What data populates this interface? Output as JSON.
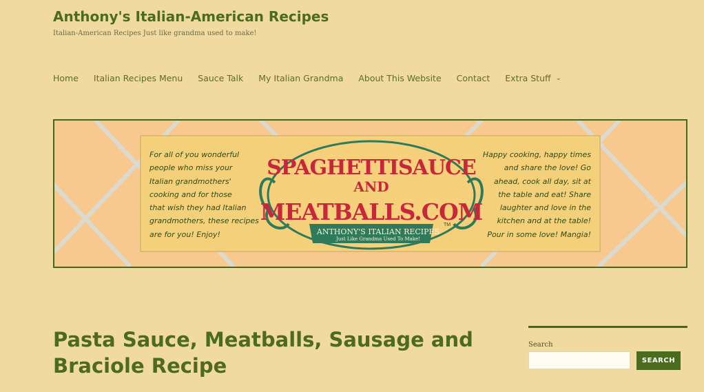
{
  "site": {
    "title": "Anthony's Italian-American Recipes",
    "tagline": "Italian-American Recipes Just like grandma used to make!"
  },
  "nav": {
    "items": [
      {
        "label": "Home"
      },
      {
        "label": "Italian Recipes Menu"
      },
      {
        "label": "Sauce Talk"
      },
      {
        "label": "My Italian Grandma"
      },
      {
        "label": "About This Website"
      },
      {
        "label": "Contact"
      },
      {
        "label": "Extra Stuff",
        "has_dropdown": true
      }
    ],
    "dropdown_icon": "chevron-down-icon"
  },
  "banner": {
    "left_lines": [
      "For all of you wonderful",
      "people who miss your",
      "Italian grandmothers'",
      "cooking and for those",
      "that wish they had Italian",
      "grandmothers, these recipes",
      "are for you! Enjoy!"
    ],
    "right_lines": [
      "Happy cooking, happy times",
      "and share the love! Go",
      "ahead, cook all day, sit at",
      "the table and eat! Share",
      "laughter and love in the",
      "kitchen and at the table!",
      "Pour in some love! Mangia!"
    ],
    "logo_line1": "SPAGHETTISAUCE",
    "logo_and": "AND",
    "logo_line2": "MEATBALLS.COM",
    "logo_tm": "TM",
    "logo_sub1": "ANTHONY'S ITALIAN RECIPES",
    "logo_sub2": "Just Like Grandma Used To Make!"
  },
  "post": {
    "title_line1": "Pasta Sauce, Meatballs, Sausage and",
    "title_line2": "Braciole Recipe"
  },
  "sidebar": {
    "search_label": "Search",
    "search_placeholder": "",
    "search_button": "SEARCH"
  },
  "colors": {
    "page_bg": "#f1da9f",
    "brand_green": "#4b6b1f",
    "logo_red": "#c8273b"
  }
}
